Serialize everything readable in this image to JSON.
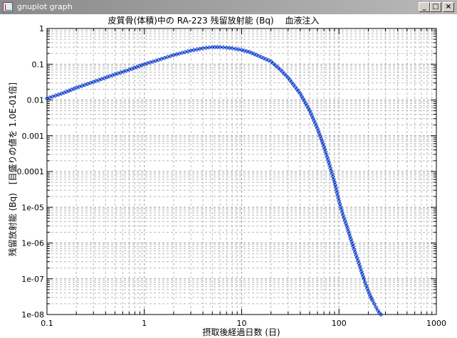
{
  "window": {
    "title": "gnuplot graph",
    "min_glyph": "_",
    "max_glyph": "□",
    "close_glyph": "×",
    "icon": "gnuplot-app-icon"
  },
  "chart_data": {
    "type": "line",
    "title": "皮質骨(体積)中の RA-223 残留放射能 (Bq)　 血液注入",
    "xlabel": "摂取後経過日数 (日)",
    "ylabel": "残留放射能 (Bq)　[目盛りの値を 1.0E-01倍]",
    "xscale": "log",
    "yscale": "log",
    "xlim": [
      0.1,
      1000
    ],
    "ylim": [
      1e-08,
      1
    ],
    "grid": true,
    "x_tick_labels": [
      "0.1",
      "1",
      "10",
      "100",
      "1000"
    ],
    "y_tick_labels": [
      "1e-08",
      "1e-07",
      "1e-06",
      "1e-05",
      "0.0001",
      "0.001",
      "0.01",
      "0.1",
      "1"
    ],
    "marker": "diamond",
    "color": "#0033cc",
    "series": [
      {
        "x": [
          0.1,
          0.15,
          0.2,
          0.3,
          0.5,
          0.7,
          1,
          1.5,
          2,
          3,
          4,
          5,
          6,
          7,
          8,
          10,
          12,
          15,
          20,
          25,
          30,
          40,
          50,
          60,
          70,
          80,
          90,
          100,
          110,
          120,
          130,
          140,
          150,
          160,
          170,
          180,
          190,
          200,
          210,
          220,
          230,
          240,
          250,
          260,
          270
        ],
        "y": [
          0.011,
          0.016,
          0.022,
          0.032,
          0.052,
          0.07,
          0.1,
          0.14,
          0.18,
          0.24,
          0.28,
          0.3,
          0.3,
          0.29,
          0.28,
          0.25,
          0.22,
          0.17,
          0.12,
          0.07,
          0.042,
          0.015,
          0.005,
          0.0016,
          0.0005,
          0.00015,
          5e-05,
          1.5e-05,
          6e-06,
          3e-06,
          1.5e-06,
          8e-07,
          4.5e-07,
          2.7e-07,
          1.6e-07,
          1e-07,
          6.5e-08,
          4.5e-08,
          3.3e-08,
          2.5e-08,
          2e-08,
          1.6e-08,
          1.3e-08,
          1.1e-08,
          1e-08
        ]
      }
    ]
  }
}
